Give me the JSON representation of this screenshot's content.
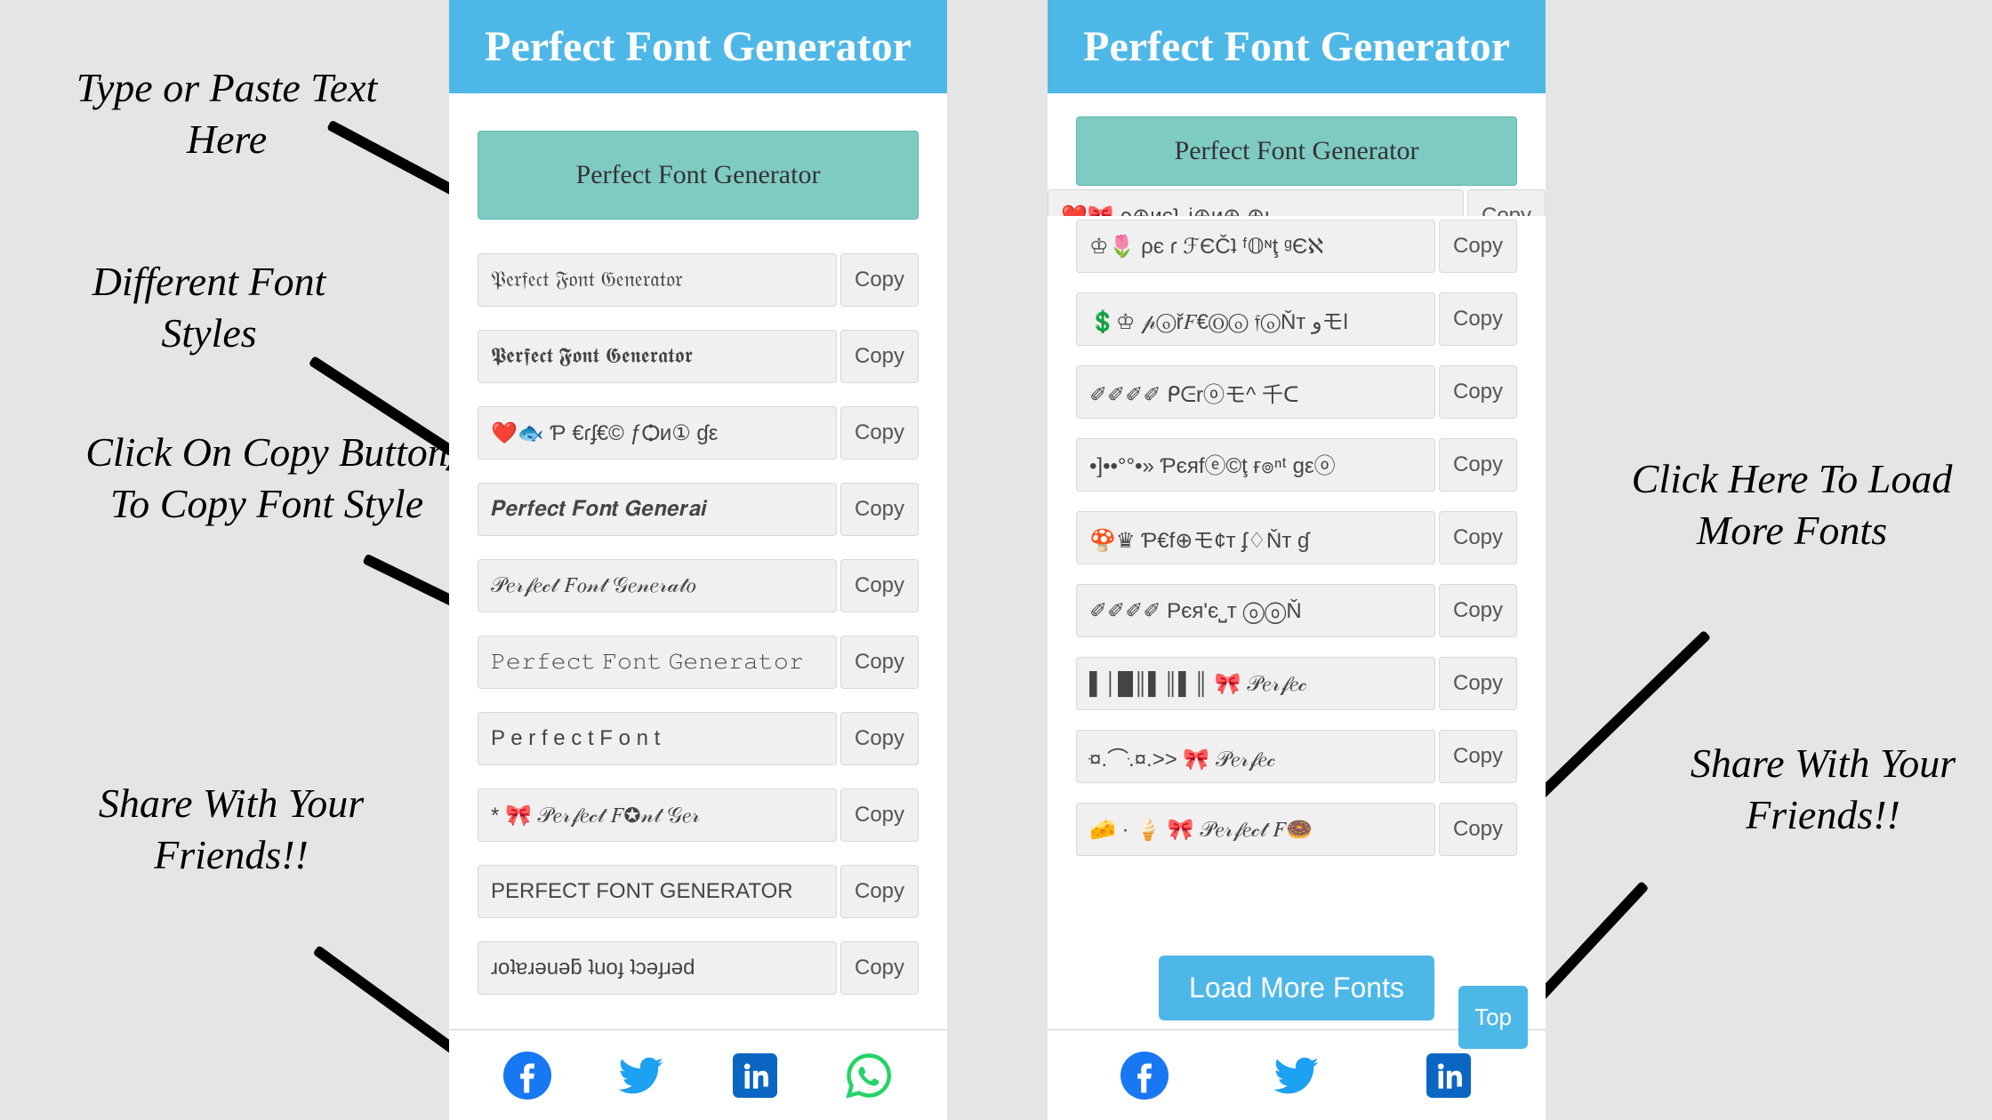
{
  "app_title": "Perfect Font Generator",
  "input_text": "Perfect Font Generator",
  "copy_label": "Copy",
  "load_more_label": "Load More Fonts",
  "top_label": "Top",
  "left_results": [
    "𝔓𝔢𝔯𝔣𝔢𝔠𝔱 𝔉𝔬𝔫𝔱 𝔊𝔢𝔫𝔢𝔯𝔞𝔱𝔬𝔯",
    "𝕻𝖊𝖗𝖋𝖊𝖈𝖙 𝕱𝖔𝖓𝖙 𝕲𝖊𝖓𝖊𝖗𝖆𝖙𝖔𝖗",
    "❤️🐟  Ƥ €ɾʄ€© ƒѺи① ɠε",
    "𝑷𝒆𝒓𝒇𝒆𝒄𝒕 𝑭𝒐𝒏𝒕 𝑮𝒆𝒏𝒆𝒓𝒂𝒊",
    "𝒫𝑒𝓇𝒻𝑒𝒸𝓉 𝐹𝑜𝓃𝓉 𝒢𝑒𝓃𝑒𝓇𝒶𝓉𝑜",
    "𝙿𝚎𝚛𝚏𝚎𝚌𝚝 𝙵𝚘𝚗𝚝 𝙶𝚎𝚗𝚎𝚛𝚊𝚝𝚘𝚛",
    "P e r f e c t  F o n t",
    "*  🎀  𝒫𝑒𝓇𝒻𝑒𝒸𝓉 𝐹✪𝓃𝓉 𝒢𝑒𝓇",
    "PERFECT FONT GENERATOR",
    "ɹoʇɐɹǝuǝƃ ʇuoɟ ʇɔǝɟɹǝd"
  ],
  "right_results": [
    "♔🌷  ρє ɾ ℱЄČʇ ᶠ𝕆ᶰţ ᵍЄℵ",
    "💲♔  𝓅ⓞř𝐹€Ⓞⓞ 𝔣ⓞŇт ﻭモl",
    "✐✐✐✐   ᑭᕮrⓞモ^ 千ᑕ",
    "•]••°°•» Ƥєяfⓔ©ţ ғ๏ⁿᵗ gεⓞ",
    "🍄♛  Ƥ€f⊕モ¢т ʄ♢Ňт ɠ",
    "✐✐✐✐  Pєя'є⎵т ⓞⓞŇ",
    "▌│█║▌║▌║  🎀  𝒫𝑒𝓇𝒻𝑒𝒸",
    "¤ּ.⌒.ּ¤.>>  🎀  𝒫𝑒𝓇𝒻𝑒𝒸",
    "🧀 · 🍦 🎀  𝒫𝑒𝓇𝒻𝑒𝒸𝓉 𝐹🍩"
  ],
  "annotations": {
    "a1": "Type or Paste Text Here",
    "a2": "Different Font Styles",
    "a3": "Click On Copy Button To Copy Font Style",
    "a4": "Share With Your Friends!!",
    "a5": "Click Here To Load More Fonts",
    "a6": "Share With Your Friends!!"
  },
  "social": [
    "facebook",
    "twitter",
    "linkedin",
    "whatsapp"
  ]
}
